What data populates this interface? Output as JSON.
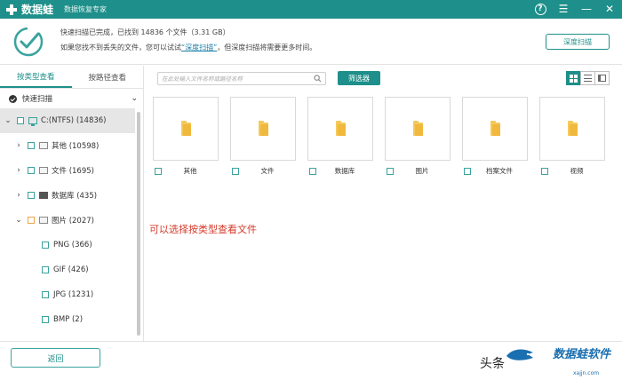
{
  "titlebar": {
    "app_name": "数据蛙",
    "subtitle": "数据恢复专家"
  },
  "status": {
    "line1_prefix": "快速扫描已完成，已找到",
    "file_count": "14836",
    "line1_middle": "个文件（3.31 GB）",
    "line2_prefix": "如果您找不到丢失的文件，您可以试试",
    "deep_scan_link": "“深度扫描”",
    "line2_suffix": "，但深度扫描将需要更多时间。",
    "deep_scan_button": "深度扫描"
  },
  "sidebar": {
    "tabs": [
      {
        "label": "按类型查看",
        "active": true
      },
      {
        "label": "按路径查看",
        "active": false
      }
    ],
    "scan_mode": "快速扫描",
    "tree": [
      {
        "label": "C:(NTFS) (14836)",
        "level": 0
      },
      {
        "label": "其他 (10598)",
        "level": 1
      },
      {
        "label": "文件 (1695)",
        "level": 1
      },
      {
        "label": "数据库 (435)",
        "level": 1
      },
      {
        "label": "图片 (2027)",
        "level": 1
      },
      {
        "label": "PNG (366)",
        "level": 2
      },
      {
        "label": "GIF (426)",
        "level": 2
      },
      {
        "label": "JPG (1231)",
        "level": 2
      },
      {
        "label": "BMP (2)",
        "level": 2
      }
    ]
  },
  "toolbar": {
    "search_placeholder": "在此处输入文件名称或路径名称",
    "filter_button": "筛选器"
  },
  "tiles": [
    {
      "label": "其他"
    },
    {
      "label": "文件"
    },
    {
      "label": "数据库"
    },
    {
      "label": "图片"
    },
    {
      "label": "档案文件"
    },
    {
      "label": "视频"
    }
  ],
  "annotation": "可以选择按类型查看文件",
  "bottom": {
    "back_button": "返回"
  },
  "watermark": {
    "text1": "头条",
    "logo": "数据蛙软件",
    "url": "xajjn.com"
  },
  "colors": {
    "brand": "#1e8f8a",
    "annotation": "#d43a2b",
    "folder": "#f5c95a"
  }
}
